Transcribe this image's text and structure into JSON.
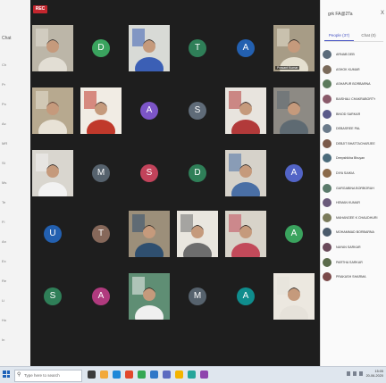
{
  "left_pane": {
    "lines": [
      "Ch",
      "Pr",
      "Po",
      "Ac",
      "MR",
      "St",
      "Ms",
      "Te",
      "Fi",
      "An",
      "Ex",
      "Re",
      "Li",
      "Ho",
      "In"
    ],
    "chat_tab": "Chat"
  },
  "meeting": {
    "rec_label": "REC",
    "tiles": [
      {
        "kind": "video",
        "theme": "room"
      },
      {
        "kind": "avatar",
        "initial": "D",
        "color": "#3aa35e"
      },
      {
        "kind": "video",
        "theme": "man_blue"
      },
      {
        "kind": "avatar",
        "initial": "T",
        "color": "#2f7f58"
      },
      {
        "kind": "avatar",
        "initial": "A",
        "color": "#2360b0"
      },
      {
        "kind": "video",
        "theme": "man_room",
        "name": "Prasant Kumar"
      },
      {
        "kind": "video",
        "theme": "woman_door"
      },
      {
        "kind": "video",
        "theme": "woman_red"
      },
      {
        "kind": "avatar",
        "initial": "A",
        "color": "#7c55c7"
      },
      {
        "kind": "avatar",
        "initial": "S",
        "color": "#5f6b78"
      },
      {
        "kind": "video",
        "theme": "man_red"
      },
      {
        "kind": "video",
        "theme": "man_dark"
      },
      {
        "kind": "video",
        "theme": "man_white"
      },
      {
        "kind": "avatar",
        "initial": "M",
        "color": "#56626d"
      },
      {
        "kind": "avatar",
        "initial": "S",
        "color": "#c2435b"
      },
      {
        "kind": "avatar",
        "initial": "D",
        "color": "#2f7f58"
      },
      {
        "kind": "video",
        "theme": "man_stripe"
      },
      {
        "kind": "avatar",
        "initial": "A",
        "color": "#5264c6"
      },
      {
        "kind": "avatar",
        "initial": "U",
        "color": "#2360b0"
      },
      {
        "kind": "avatar",
        "initial": "T",
        "color": "#86685a"
      },
      {
        "kind": "video",
        "theme": "man_shelf"
      },
      {
        "kind": "video",
        "theme": "man_wall"
      },
      {
        "kind": "video",
        "theme": "girl"
      },
      {
        "kind": "avatar",
        "initial": "A",
        "color": "#3aa35e"
      },
      {
        "kind": "avatar",
        "initial": "S",
        "color": "#2f7f58"
      },
      {
        "kind": "avatar",
        "initial": "A",
        "color": "#b03a7e"
      },
      {
        "kind": "video",
        "theme": "man_green"
      },
      {
        "kind": "avatar",
        "initial": "M",
        "color": "#56626d"
      },
      {
        "kind": "avatar",
        "initial": "A",
        "color": "#0f8d8d"
      },
      {
        "kind": "video",
        "theme": "man_light"
      }
    ]
  },
  "panel": {
    "title": "grk FA@2Ta",
    "close": "X",
    "tab_people": "People (37)",
    "tab_chat": "Chat (0)",
    "participants": [
      {
        "name": "ARNAB DEB",
        "color": "#5b6b7a"
      },
      {
        "name": "ASHOK KUMAR",
        "color": "#7a6a5a"
      },
      {
        "name": "ASHAPUR BORBARNA",
        "color": "#5c7a5c"
      },
      {
        "name": "BAISHALI CHAKRABORTY",
        "color": "#8a5a6a"
      },
      {
        "name": "BINOD SARKAR",
        "color": "#5a5a8a"
      },
      {
        "name": "DEBASREE PAL",
        "color": "#6a7a8a"
      },
      {
        "name": "DEBJIT BHATTACHARJEE",
        "color": "#7a5a4a"
      },
      {
        "name": "Deepshikha Bhuyan",
        "color": "#4a6a7a"
      },
      {
        "name": "DIYA SAIKIA",
        "color": "#8a6a4a"
      },
      {
        "name": "GARGABINA BORBORAH",
        "color": "#5a7a6a"
      },
      {
        "name": "HEMAN KUMAR",
        "color": "#6a5a7a"
      },
      {
        "name": "MAHANGEE K CHAUDHURI",
        "color": "#7a7a5a"
      },
      {
        "name": "MOHAMMAD BORBARNA",
        "color": "#4a5a6a"
      },
      {
        "name": "NAYAN SARKAR",
        "color": "#6a4a5a"
      },
      {
        "name": "PARTHA SARKAR",
        "color": "#5a6a4a"
      },
      {
        "name": "PRAKASH SHARMA",
        "color": "#7a4a4a"
      }
    ]
  },
  "taskbar": {
    "search_placeholder": "Type here to search",
    "search_icon": "magnifier-icon",
    "app_colors": [
      "#3b3b3b",
      "#f2a93b",
      "#1e88d8",
      "#e2472c",
      "#34a853",
      "#2f78c8",
      "#5c6bc0",
      "#f4b400",
      "#26a69a",
      "#8e44ad"
    ],
    "time": "15:05",
    "date": "20-06-2020"
  }
}
